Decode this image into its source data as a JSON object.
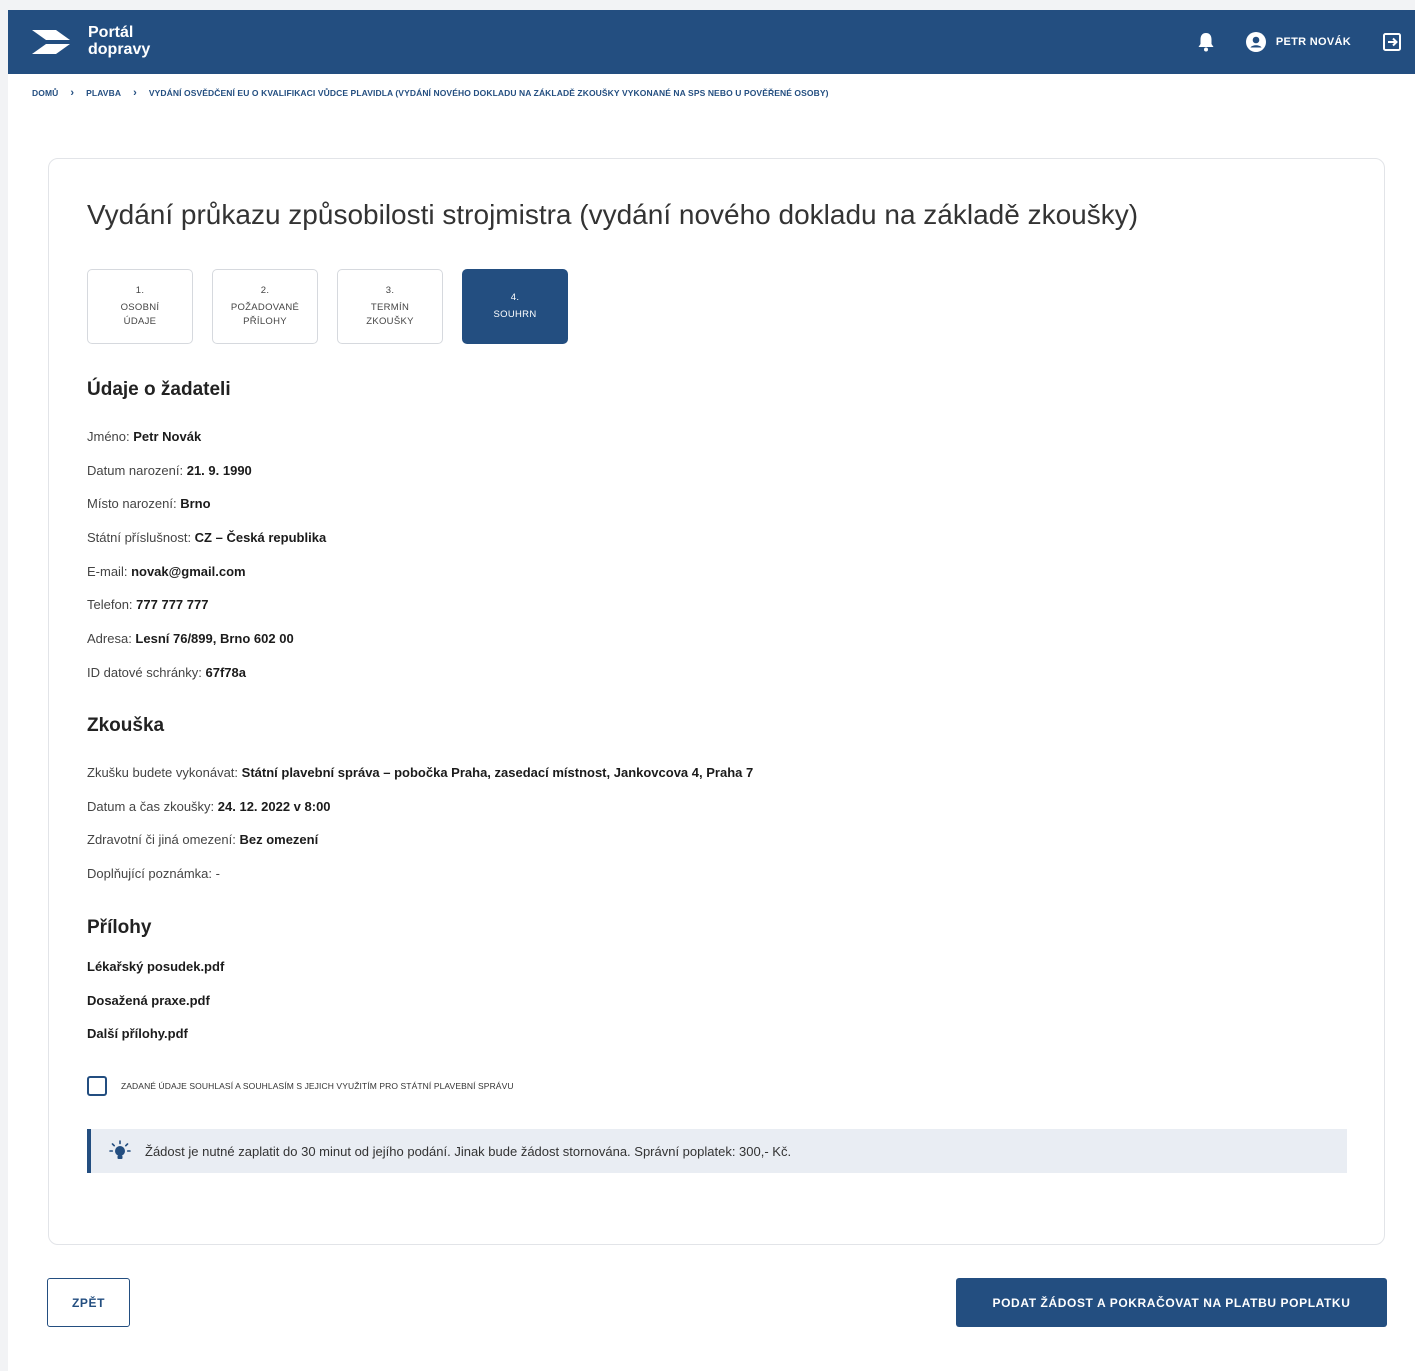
{
  "header": {
    "logo_line1": "Portál",
    "logo_line2": "dopravy",
    "user_name": "PETR NOVÁK",
    "brand_color": "#234e80",
    "icons": [
      "logo-icon",
      "bell-icon",
      "user-avatar-icon",
      "logout-icon"
    ]
  },
  "breadcrumb": {
    "items": [
      "DOMŮ",
      "PLAVBA",
      "VYDÁNÍ OSVĚDČENÍ EU O KVALIFIKACI VŮDCE PLAVIDLA (VYDÁNÍ NOVÉHO DOKLADU NA ZÁKLADĚ ZKOUŠKY VYKONANÉ NA SPS NEBO U POVĚŘENÉ OSOBY)"
    ]
  },
  "page": {
    "title": "Vydání průkazu způsobilosti strojmistra (vydání nového dokladu na základě zkoušky)"
  },
  "steps": [
    {
      "num": "1.",
      "line1": "OSOBNÍ",
      "line2": "ÚDAJE"
    },
    {
      "num": "2.",
      "line1": "POŽADOVANÉ",
      "line2": "PŘÍLOHY"
    },
    {
      "num": "3.",
      "line1": "TERMÍN",
      "line2": "ZKOUŠKY"
    },
    {
      "num": "4.",
      "line1": "SOUHRN",
      "line2": ""
    }
  ],
  "applicant": {
    "heading": "Údaje o žadateli",
    "fields": [
      {
        "label": "Jméno: ",
        "value": "Petr Novák"
      },
      {
        "label": "Datum narození: ",
        "value": "21. 9. 1990"
      },
      {
        "label": "Místo narození: ",
        "value": "Brno"
      },
      {
        "label": "Státní příslušnost: ",
        "value": "CZ – Česká republika"
      },
      {
        "label": "E-mail: ",
        "value": "novak@gmail.com"
      },
      {
        "label": "Telefon: ",
        "value": "777 777 777"
      },
      {
        "label": "Adresa: ",
        "value": "Lesní 76/899, Brno 602 00"
      },
      {
        "label": "ID datové schránky: ",
        "value": "67f78a"
      }
    ]
  },
  "exam": {
    "heading": "Zkouška",
    "fields": [
      {
        "label": "Zkušku budete vykonávat: ",
        "value": "Státní plavební správa – pobočka Praha, zasedací místnost, Jankovcova 4, Praha 7"
      },
      {
        "label": "Datum a čas zkoušky: ",
        "value": "24. 12. 2022 v 8:00"
      },
      {
        "label": "Zdravotní či jiná omezení: ",
        "value": "Bez omezení"
      },
      {
        "label": "Doplňující poznámka: -",
        "value": ""
      }
    ]
  },
  "attachments": {
    "heading": "Přílohy",
    "files": [
      "Lékařský posudek.pdf",
      "Dosažená praxe.pdf",
      "Další přílohy.pdf"
    ]
  },
  "consent": {
    "label": "ZADANÉ ÚDAJE SOUHLASÍ A SOUHLASÍM S JEJICH VYUŽITÍM PRO STÁTNÍ PLAVEBNÍ SPRÁVU",
    "checked": false
  },
  "notice": {
    "text": "Žádost je nutné zaplatit do 30 minut od jejího podání. Jinak bude žádost stornována. Správní poplatek: 300,- Kč.",
    "icon": "lightbulb-icon"
  },
  "actions": {
    "back_label": "ZPĚT",
    "submit_label": "PODAT ŽÁDOST A POKRAČOVAT NA PLATBU POPLATKU"
  }
}
